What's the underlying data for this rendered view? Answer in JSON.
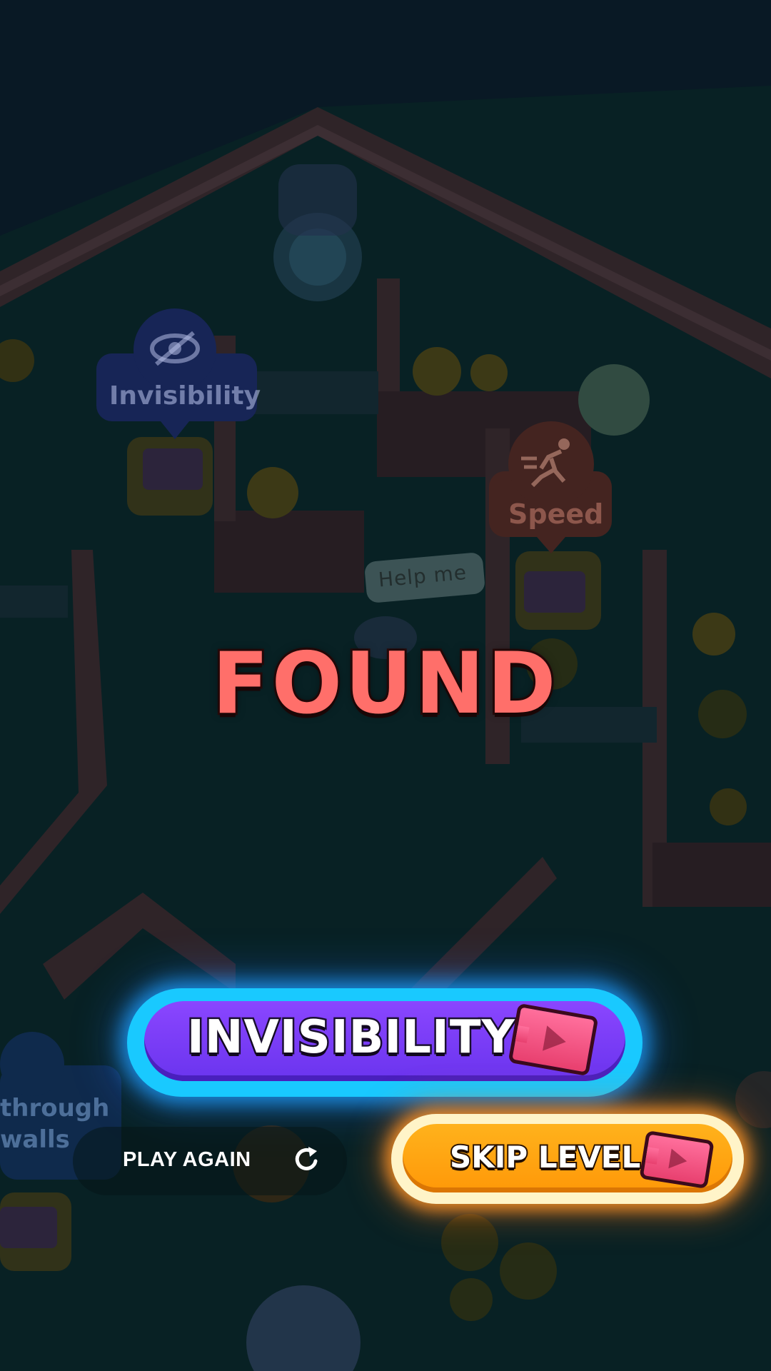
{
  "title": "FOUND",
  "scene": {
    "powerup_labels": {
      "invisibility": "Invisibility",
      "speed": "Speed",
      "walls_line1": "through",
      "walls_line2": "walls"
    },
    "speech_bubble": "Help me"
  },
  "buttons": {
    "invisibility": "INVISIBILITY",
    "play_again": "PLAY AGAIN",
    "skip_level": "SKIP LEVEL"
  },
  "icons": {
    "ticket": "ticket-icon",
    "replay": "replay-icon",
    "invisibility": "eye-slash-icon",
    "speed": "running-man-icon"
  },
  "colors": {
    "found_text": "#ff6f6a",
    "invisibility_button": "#7b3cf4",
    "invisibility_glow": "#19c9ff",
    "skip_button": "#ffa412",
    "ticket": "#f2527f"
  }
}
